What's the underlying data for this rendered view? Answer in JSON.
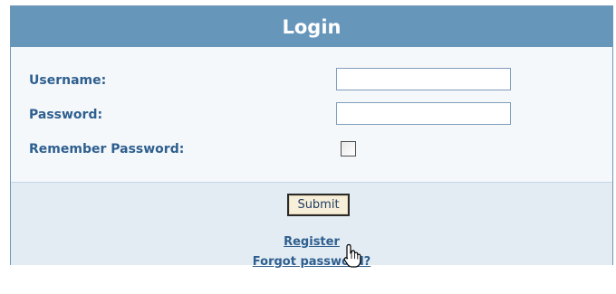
{
  "login": {
    "title": "Login",
    "fields": {
      "username_label": "Username:",
      "password_label": "Password:",
      "remember_label": "Remember Password:",
      "username_value": "",
      "password_value": ""
    },
    "remember_checked": false,
    "submit_label": "Submit",
    "links": {
      "register": "Register",
      "forgot_password": "Forgot password?"
    }
  },
  "colors": {
    "header_bg": "#6796bb",
    "label_text": "#2e5f8f",
    "form_bg": "#f5f8fb",
    "action_bg": "#e4ecf3"
  },
  "icons": {
    "cursor": "hand-pointer-cursor-icon"
  }
}
